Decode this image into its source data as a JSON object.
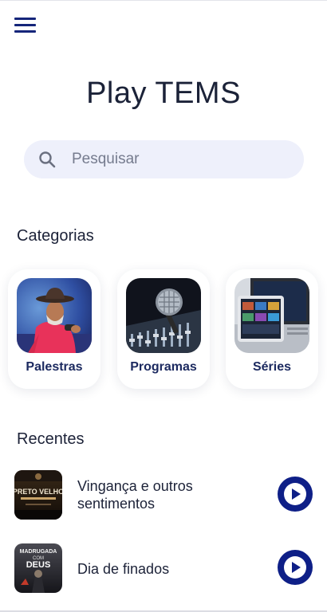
{
  "header": {
    "menu_icon": "hamburger-menu-icon",
    "title": "Play TEMS"
  },
  "search": {
    "placeholder": "Pesquisar",
    "icon": "search-icon"
  },
  "categories": {
    "title": "Categorias",
    "items": [
      {
        "label": "Palestras",
        "image": "speaker-with-hat-photo"
      },
      {
        "label": "Programas",
        "image": "microphone-mixer-photo"
      },
      {
        "label": "Séries",
        "image": "laptop-tablet-photo"
      }
    ]
  },
  "recent": {
    "title": "Recentes",
    "items": [
      {
        "title": "Vingança e outros sentimentos",
        "thumb_text": [
          "PRETO VELHO"
        ],
        "play_icon": "play-icon"
      },
      {
        "title": "Dia de finados",
        "thumb_text": [
          "MADRUGADA",
          "COM",
          "DEUS"
        ],
        "play_icon": "play-icon"
      }
    ]
  },
  "colors": {
    "accent": "#0e1f87",
    "search_bg": "#eef0fb",
    "text": "#1c2238"
  }
}
